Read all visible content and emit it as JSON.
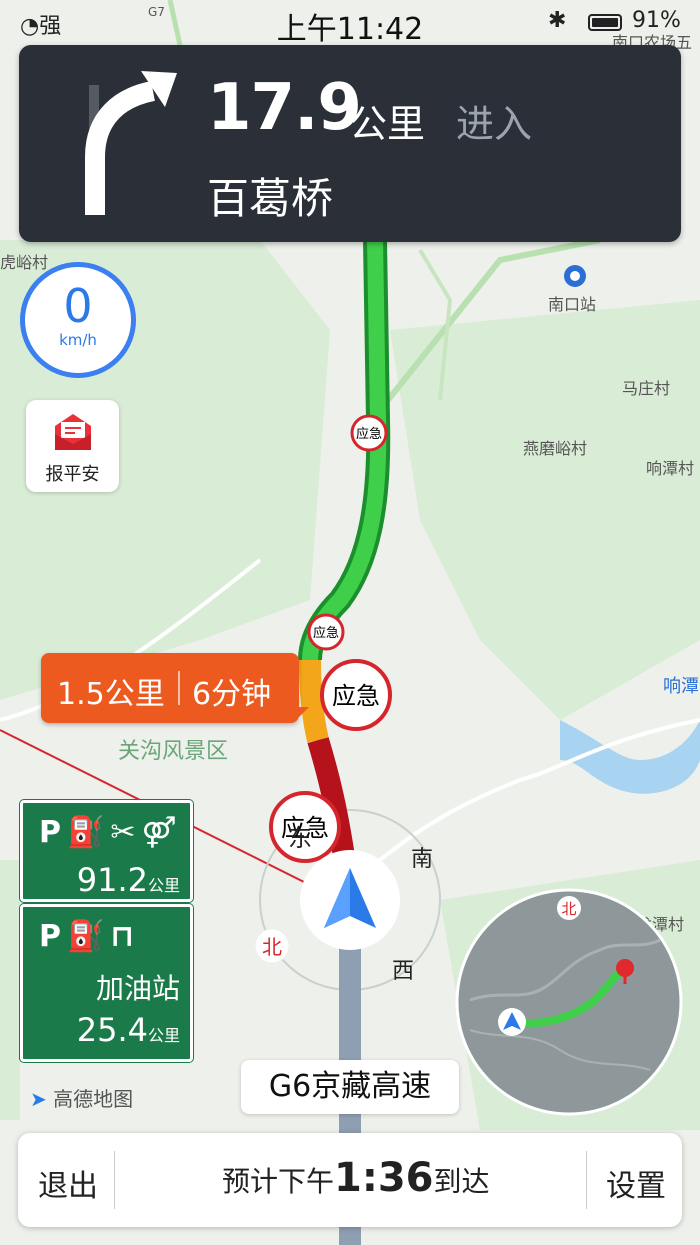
{
  "status_bar": {
    "signal": "强",
    "time": "上午11:42",
    "battery": "91%"
  },
  "guidance": {
    "distance": "17.9",
    "unit": "公里",
    "action": "进入",
    "road": "百葛桥"
  },
  "speedometer": {
    "value": "0",
    "unit": "km/h"
  },
  "safe_button": {
    "label": "报平安"
  },
  "traffic_callout": {
    "distance": "1.5公里",
    "duration": "6分钟"
  },
  "map_labels": {
    "huyu": "虎峪村",
    "nankou_station": "南口站",
    "mazhuang": "马庄村",
    "yanmo": "燕磨峪村",
    "xiangtan_cun": "响潭村",
    "xiangtan": "响潭",
    "guangou": "关沟风景区",
    "longtan": "龙潭村",
    "nankou_farm": "南口农场五",
    "g7": "G7"
  },
  "emergency_badges": [
    "应急",
    "应急",
    "应急",
    "应急"
  ],
  "compass": {
    "north": "北",
    "south": "南",
    "west": "西",
    "east": "东"
  },
  "minimap": {
    "north": "北"
  },
  "service_areas": [
    {
      "distance": "91.2",
      "unit": "公里",
      "amenities": [
        "parking",
        "fuel",
        "restaurant",
        "restroom"
      ]
    },
    {
      "type": "加油站",
      "distance": "25.4",
      "unit": "公里",
      "amenities": [
        "parking",
        "fuel",
        "shopping"
      ]
    }
  ],
  "app_logo": "高德地图",
  "current_road": "G6京藏高速",
  "bottom_bar": {
    "exit": "退出",
    "eta_prefix": "预计下午",
    "eta_time": "1:36",
    "eta_suffix": "到达",
    "settings": "设置"
  },
  "colors": {
    "route_smooth": "#2fbf3a",
    "route_slow": "#f3a61a",
    "route_jam": "#b5121b",
    "nav_panel": "#2a2f38",
    "callout": "#ec5a1f",
    "service_sign": "#1b7a4a",
    "accent": "#2b7ae8"
  }
}
